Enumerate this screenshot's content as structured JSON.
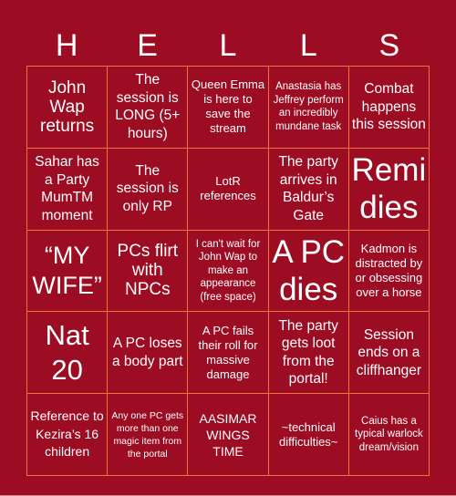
{
  "title_letters": [
    "H",
    "E",
    "L",
    "L",
    "S"
  ],
  "colors": {
    "background": "#9c0c22",
    "grid_lines": "#f0743a",
    "text": "#ffffff"
  },
  "board": [
    [
      "John Wap returns",
      "The session is LONG (5+ hours)",
      "Queen Emma is here to save the stream",
      "Anastasia has Jeffrey perform an incredibly mundane task",
      "Combat happens this session"
    ],
    [
      "Sahar has a Party MumTM moment",
      "The session is only RP",
      "LotR references",
      "The party arrives in Baldur’s Gate",
      "Remi dies"
    ],
    [
      "“MY WIFE”",
      "PCs flirt with NPCs",
      "I can't wait for John Wap to make an appearance (free space)",
      "A PC dies",
      "Kadmon is distracted by or obsessing over a horse"
    ],
    [
      "Nat 20",
      "A PC loses a body part",
      "A PC fails their roll for massive damage",
      "The party gets loot from the portal!",
      "Session ends on a cliffhanger"
    ],
    [
      "Reference to Kezira’s 16 children",
      "Any one PC gets more than one magic item from the portal",
      "AASIMAR WINGS TIME",
      "~technical difficulties~",
      "Caius has a typical warlock dream/vision"
    ]
  ],
  "free_space": {
    "row": 2,
    "col": 2
  }
}
